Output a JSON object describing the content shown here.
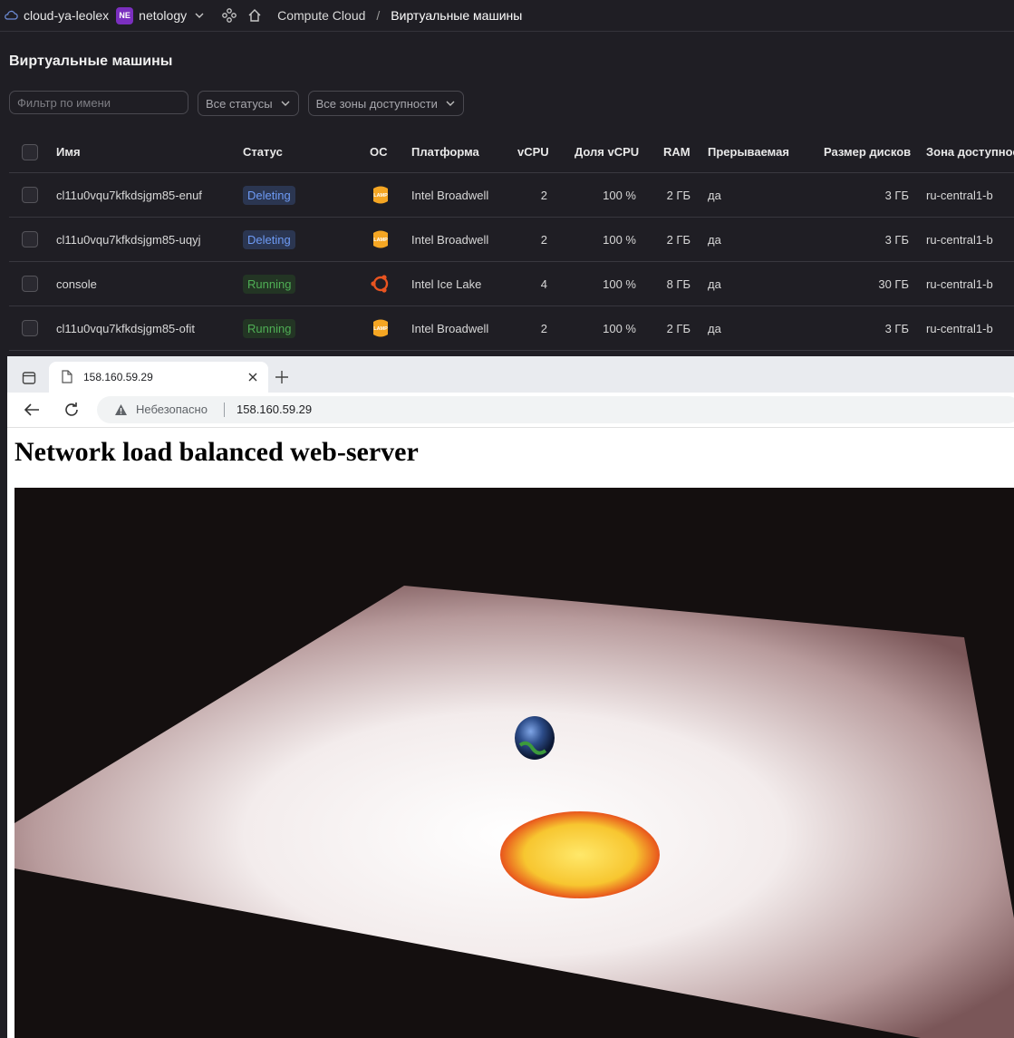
{
  "topbar": {
    "cloud_name": "cloud-ya-leolex",
    "folder_badge": "NE",
    "folder_name": "netology",
    "breadcrumb_service": "Compute Cloud",
    "breadcrumb_separator": "/",
    "breadcrumb_page": "Виртуальные машины"
  },
  "page": {
    "title": "Виртуальные машины"
  },
  "filters": {
    "name_placeholder": "Фильтр по имени",
    "status_select": "Все статусы",
    "zone_select": "Все зоны доступности"
  },
  "table": {
    "headers": {
      "name": "Имя",
      "status": "Статус",
      "os": "ОС",
      "platform": "Платформа",
      "vcpu": "vCPU",
      "vcpu_share": "Доля vCPU",
      "ram": "RAM",
      "preemptible": "Прерываемая",
      "disk_size": "Размер дисков",
      "zone": "Зона доступност"
    },
    "rows": [
      {
        "name": "cl11u0vqu7kfkdsjgm85-enuf",
        "status": "Deleting",
        "os": "lamp-icon",
        "platform": "Intel Broadwell",
        "vcpu": "2",
        "vcpu_share": "100 %",
        "ram": "2 ГБ",
        "preemptible": "да",
        "disk_size": "3 ГБ",
        "zone": "ru-central1-b"
      },
      {
        "name": "cl11u0vqu7kfkdsjgm85-uqyj",
        "status": "Deleting",
        "os": "lamp-icon",
        "platform": "Intel Broadwell",
        "vcpu": "2",
        "vcpu_share": "100 %",
        "ram": "2 ГБ",
        "preemptible": "да",
        "disk_size": "3 ГБ",
        "zone": "ru-central1-b"
      },
      {
        "name": "console",
        "status": "Running",
        "os": "ubuntu-icon",
        "platform": "Intel Ice Lake",
        "vcpu": "4",
        "vcpu_share": "100 %",
        "ram": "8 ГБ",
        "preemptible": "да",
        "disk_size": "30 ГБ",
        "zone": "ru-central1-b"
      },
      {
        "name": "cl11u0vqu7kfkdsjgm85-ofit",
        "status": "Running",
        "os": "lamp-icon",
        "platform": "Intel Broadwell",
        "vcpu": "2",
        "vcpu_share": "100 %",
        "ram": "2 ГБ",
        "preemptible": "да",
        "disk_size": "3 ГБ",
        "zone": "ru-central1-b"
      }
    ]
  },
  "os_icon_text": "LAMP",
  "browser": {
    "tab_title": "158.160.59.29",
    "insecure_label": "Небезопасно",
    "url": "158.160.59.29",
    "page_heading": "Network load balanced web-server"
  },
  "colors": {
    "console_bg": "#1f1e24",
    "deleting": "#6e9bf5",
    "running": "#4fae55",
    "lamp": "#f5a623",
    "ubuntu": "#e95420"
  }
}
